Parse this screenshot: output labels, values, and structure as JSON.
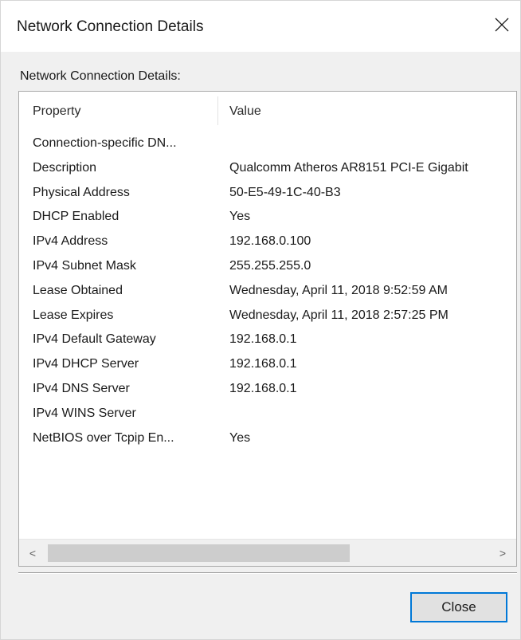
{
  "window": {
    "title": "Network Connection Details",
    "close_icon": "close-icon"
  },
  "group_label": "Network Connection Details:",
  "table": {
    "columns": [
      "Property",
      "Value"
    ],
    "rows": [
      {
        "property": "Connection-specific DN...",
        "value": ""
      },
      {
        "property": "Description",
        "value": "Qualcomm Atheros AR8151 PCI-E Gigabit"
      },
      {
        "property": "Physical Address",
        "value": "50-E5-49-1C-40-B3"
      },
      {
        "property": "DHCP Enabled",
        "value": "Yes"
      },
      {
        "property": "IPv4 Address",
        "value": "192.168.0.100"
      },
      {
        "property": "IPv4 Subnet Mask",
        "value": "255.255.255.0"
      },
      {
        "property": "Lease Obtained",
        "value": "Wednesday, April 11, 2018 9:52:59 AM"
      },
      {
        "property": "Lease Expires",
        "value": "Wednesday, April 11, 2018 2:57:25 PM"
      },
      {
        "property": "IPv4 Default Gateway",
        "value": "192.168.0.1"
      },
      {
        "property": "IPv4 DHCP Server",
        "value": "192.168.0.1"
      },
      {
        "property": "IPv4 DNS Server",
        "value": "192.168.0.1"
      },
      {
        "property": "IPv4 WINS Server",
        "value": ""
      },
      {
        "property": "NetBIOS over Tcpip En...",
        "value": "Yes"
      }
    ]
  },
  "scrollbar": {
    "left_arrow": "<",
    "right_arrow": ">"
  },
  "buttons": {
    "close_label": "Close"
  },
  "colors": {
    "accent": "#0078d7",
    "dialog_background": "#f0f0f0"
  }
}
